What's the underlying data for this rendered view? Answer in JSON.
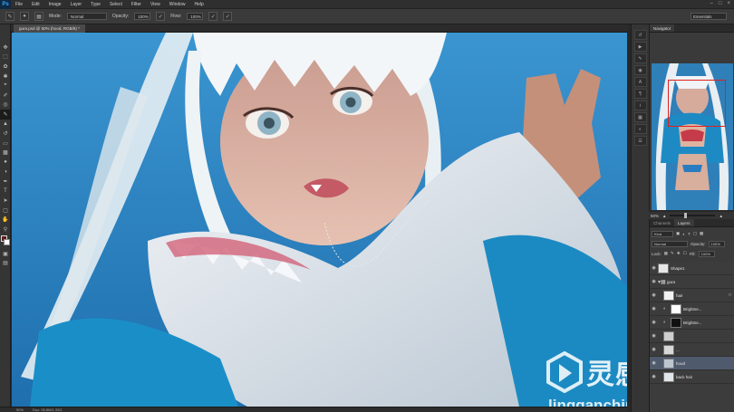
{
  "app": {
    "logo": "Ps"
  },
  "menu": [
    "File",
    "Edit",
    "Image",
    "Layer",
    "Type",
    "Select",
    "Filter",
    "View",
    "Window",
    "Help"
  ],
  "options": {
    "mode_label": "Mode:",
    "mode_value": "Normal",
    "opacity_label": "Opacity:",
    "opacity_value": "100%",
    "flow_label": "Flow:",
    "flow_value": "100%",
    "workspace": "Essentials"
  },
  "document": {
    "tab_title": "gura.psd @ 50% (hood, RGB/8) *"
  },
  "status": {
    "zoom": "50%",
    "doc_info": "Doc: 95.8M/1.33G"
  },
  "navigator": {
    "tabs": [
      "Navigator"
    ],
    "zoom": "50%",
    "zoom_level": 0.35
  },
  "layers": {
    "tabs": [
      "Channels",
      "Layers"
    ],
    "kind": "Kind",
    "blend_mode": "Normal",
    "opacity_label": "Opacity:",
    "opacity_value": "100%",
    "lock_label": "Lock:",
    "fill_label": "Fill:",
    "fill_value": "100%",
    "rows": [
      {
        "name": "Shape1",
        "kind": "layer",
        "selected": false
      },
      {
        "name": "gura",
        "kind": "group",
        "selected": false
      },
      {
        "name": "hair",
        "kind": "layer",
        "selected": false
      },
      {
        "name": "Brightne...",
        "kind": "adjustment",
        "selected": false
      },
      {
        "name": "Brightne...",
        "kind": "adjustment",
        "selected": false
      },
      {
        "name": "",
        "kind": "layer",
        "selected": false
      },
      {
        "name": "...",
        "kind": "layer",
        "selected": false
      },
      {
        "name": "hood",
        "kind": "layer",
        "selected": true
      },
      {
        "name": "back hair",
        "kind": "layer",
        "selected": false
      }
    ]
  },
  "watermark": {
    "chinese": "灵感中国",
    "url": "lingganchina.com"
  },
  "colors": {
    "canvas_bg": "#2b86c4",
    "selection": "#4f5a6d",
    "fg": "#5a1e1a",
    "bg": "#ffffff"
  }
}
